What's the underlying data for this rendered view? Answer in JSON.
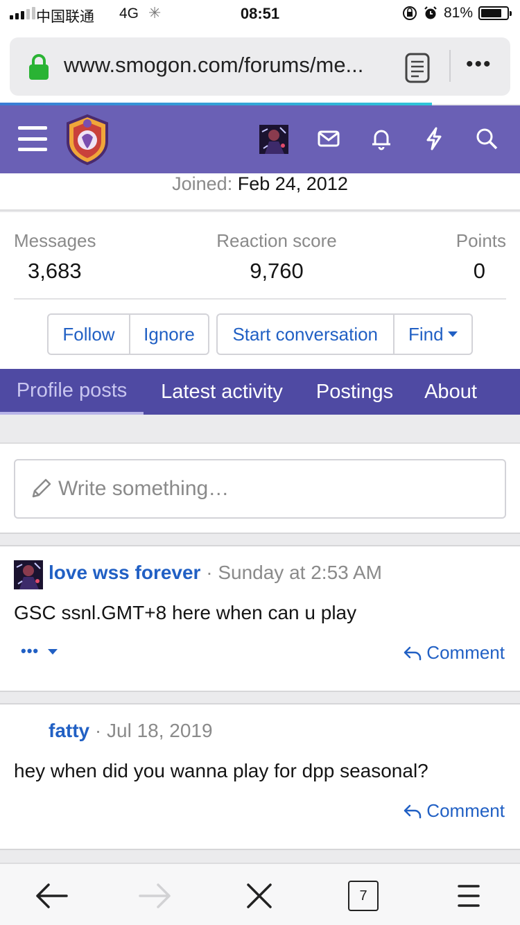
{
  "status_bar": {
    "carrier": "中国联通",
    "network": "4G",
    "time": "08:51",
    "battery_percent_label": "81%",
    "battery_level": 0.81
  },
  "browser": {
    "url": "www.smogon.com/forums/me...",
    "page_load_progress": 0.83,
    "open_tabs_count": "7"
  },
  "profile": {
    "joined_label": "Joined:",
    "joined_date": "Feb 24, 2012",
    "stats": [
      {
        "label": "Messages",
        "value": "3,683"
      },
      {
        "label": "Reaction score",
        "value": "9,760"
      },
      {
        "label": "Points",
        "value": "0"
      }
    ],
    "actions": {
      "follow": "Follow",
      "ignore": "Ignore",
      "start_conversation": "Start conversation",
      "find": "Find"
    }
  },
  "tabs": [
    {
      "label": "Profile posts",
      "active": true
    },
    {
      "label": "Latest activity",
      "active": false
    },
    {
      "label": "Postings",
      "active": false
    },
    {
      "label": "About",
      "active": false
    }
  ],
  "compose": {
    "placeholder": "Write something…"
  },
  "posts": [
    {
      "author": "love wss forever",
      "separator": "·",
      "date": "Sunday at 2:53 AM",
      "body": "GSC ssnl.GMT+8 here when can u play",
      "has_avatar": true,
      "more": "•••",
      "comment_label": "Comment"
    },
    {
      "author": "fatty",
      "separator": "·",
      "date": "Jul 18, 2019",
      "body": "hey when did you wanna play for dpp seasonal?",
      "has_avatar": false,
      "comment_label": "Comment"
    }
  ],
  "colors": {
    "header_bg": "#6a60b5",
    "tabs_bg": "#4f4aa3",
    "link": "#2160c4",
    "lock": "#2ab334"
  },
  "icons": {
    "header": [
      "menu-icon",
      "site-logo",
      "user-avatar",
      "mail-icon",
      "bell-icon",
      "bolt-icon",
      "search-icon"
    ],
    "toolbar": [
      "back-arrow-icon",
      "forward-arrow-icon",
      "close-icon",
      "tabs-icon",
      "menu-icon"
    ]
  }
}
